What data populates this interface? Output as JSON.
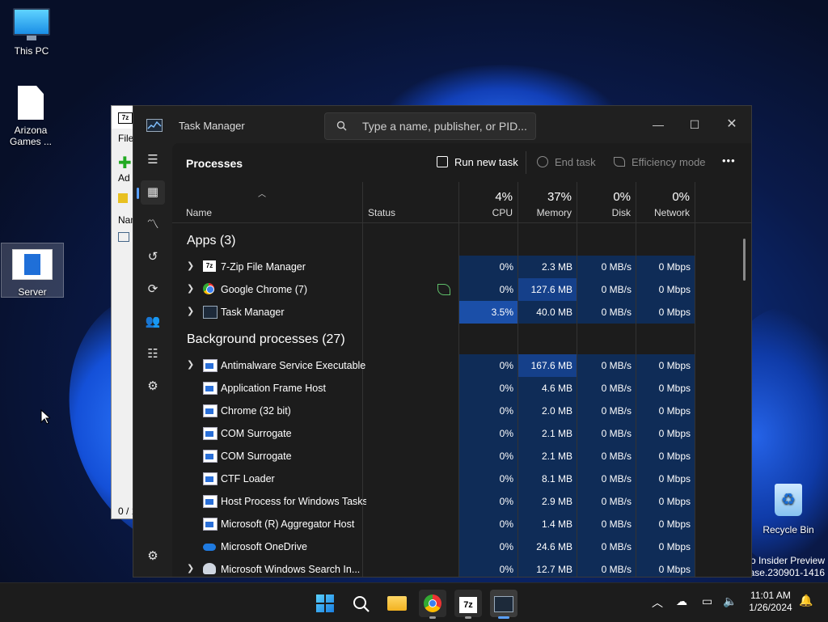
{
  "desktop": {
    "icons": [
      {
        "label": "This PC"
      },
      {
        "label": "Arizona Games ..."
      },
      {
        "label": "Server"
      },
      {
        "label": "Recycle Bin"
      }
    ],
    "watermark": {
      "line1": "ro Insider Preview",
      "line2": "ease.230901-1416"
    }
  },
  "bg_window": {
    "title_icon": "7z",
    "menu_file": "File",
    "add_label": "Ad",
    "col_name": "Nam",
    "status": "0 / 1"
  },
  "taskmanager": {
    "app_name": "Task Manager",
    "search_placeholder": "Type a name, publisher, or PID...",
    "page_title": "Processes",
    "toolbar": {
      "run_new_task": "Run new task",
      "end_task": "End task",
      "efficiency_mode": "Efficiency mode",
      "more": "•••"
    },
    "columns": {
      "name": "Name",
      "status": "Status",
      "cpu_pct": "4%",
      "cpu": "CPU",
      "mem_pct": "37%",
      "mem": "Memory",
      "disk_pct": "0%",
      "disk": "Disk",
      "net_pct": "0%",
      "net": "Network"
    },
    "groups": {
      "apps": "Apps (3)",
      "background": "Background processes (27)"
    },
    "apps": [
      {
        "name": "7-Zip File Manager",
        "cpu": "0%",
        "mem": "2.3 MB",
        "disk": "0 MB/s",
        "net": "0 Mbps"
      },
      {
        "name": "Google Chrome (7)",
        "cpu": "0%",
        "mem": "127.6 MB",
        "disk": "0 MB/s",
        "net": "0 Mbps"
      },
      {
        "name": "Task Manager",
        "cpu": "3.5%",
        "mem": "40.0 MB",
        "disk": "0 MB/s",
        "net": "0 Mbps"
      }
    ],
    "background": [
      {
        "name": "Antimalware Service Executable",
        "cpu": "0%",
        "mem": "167.6 MB",
        "disk": "0 MB/s",
        "net": "0 Mbps"
      },
      {
        "name": "Application Frame Host",
        "cpu": "0%",
        "mem": "4.6 MB",
        "disk": "0 MB/s",
        "net": "0 Mbps"
      },
      {
        "name": "Chrome (32 bit)",
        "cpu": "0%",
        "mem": "2.0 MB",
        "disk": "0 MB/s",
        "net": "0 Mbps"
      },
      {
        "name": "COM Surrogate",
        "cpu": "0%",
        "mem": "2.1 MB",
        "disk": "0 MB/s",
        "net": "0 Mbps"
      },
      {
        "name": "COM Surrogate",
        "cpu": "0%",
        "mem": "2.1 MB",
        "disk": "0 MB/s",
        "net": "0 Mbps"
      },
      {
        "name": "CTF Loader",
        "cpu": "0%",
        "mem": "8.1 MB",
        "disk": "0 MB/s",
        "net": "0 Mbps"
      },
      {
        "name": "Host Process for Windows Tasks",
        "cpu": "0%",
        "mem": "2.9 MB",
        "disk": "0 MB/s",
        "net": "0 Mbps"
      },
      {
        "name": "Microsoft (R) Aggregator Host",
        "cpu": "0%",
        "mem": "1.4 MB",
        "disk": "0 MB/s",
        "net": "0 Mbps"
      },
      {
        "name": "Microsoft OneDrive",
        "cpu": "0%",
        "mem": "24.6 MB",
        "disk": "0 MB/s",
        "net": "0 Mbps"
      },
      {
        "name": "Microsoft Windows Search In...",
        "cpu": "0%",
        "mem": "12.7 MB",
        "disk": "0 MB/s",
        "net": "0 Mbps"
      }
    ],
    "colors": {
      "heat_low": "#0f2c57",
      "heat_mid": "#15408a",
      "heat_high": "#1b4fa8"
    }
  },
  "taskbar": {
    "time": "11:01 AM",
    "date": "1/26/2024"
  }
}
